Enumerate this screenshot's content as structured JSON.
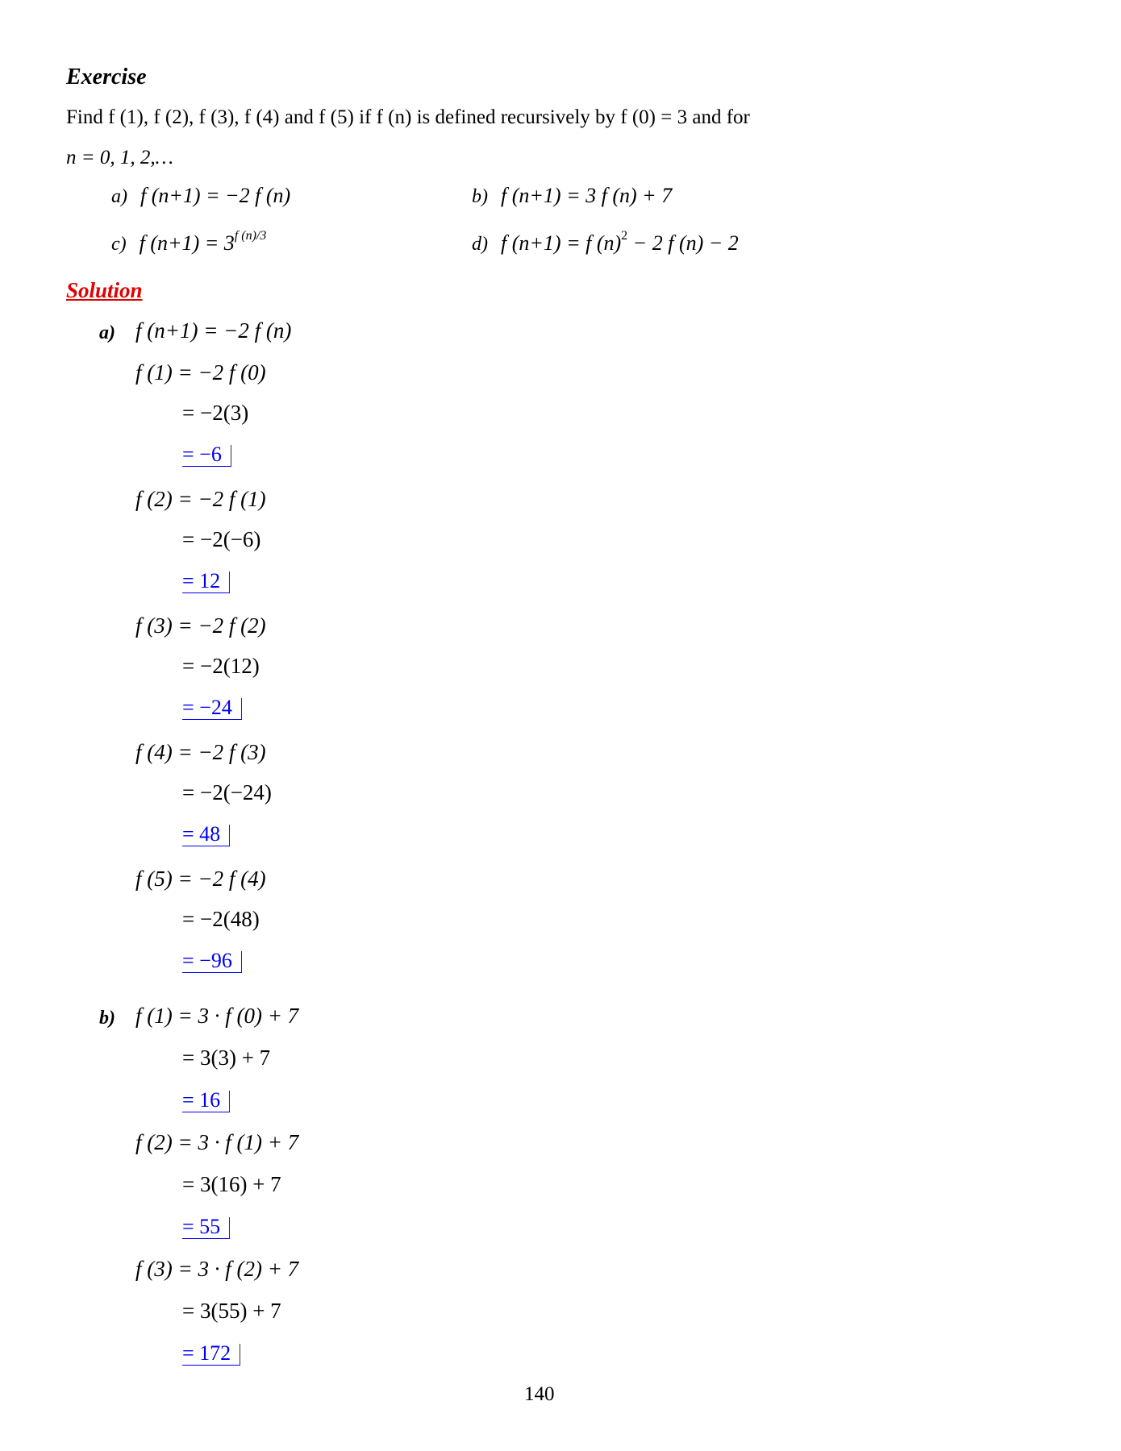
{
  "exercise": {
    "heading": "Exercise",
    "prompt_line1": "Find f (1), f (2), f (3), f (4) and f (5) if f (n) is defined recursively by f (0) = 3 and for",
    "prompt_line2": "n = 0, 1, 2,…",
    "options": [
      {
        "label": "a)",
        "expr": "f (n+1) = −2 f (n)"
      },
      {
        "label": "b)",
        "expr": "f (n+1) = 3 f (n) + 7"
      },
      {
        "label": "c)",
        "expr_base": "f (n+1) = 3",
        "expr_sup": "f (n)/3"
      },
      {
        "label": "d)",
        "expr_base": "f (n+1) = f (n)",
        "expr_sup": "2",
        "expr_tail": " − 2 f (n) − 2"
      }
    ]
  },
  "solution": {
    "heading": "Solution",
    "part_a": {
      "label": "a)",
      "rule": "f (n+1) = −2 f (n)",
      "steps": [
        {
          "expr": "f (1) = −2 f (0)",
          "work": "= −2(3)",
          "answer": "= −6"
        },
        {
          "expr": "f (2) = −2 f (1)",
          "work": "= −2(−6)",
          "answer": "= 12"
        },
        {
          "expr": "f (3) = −2 f (2)",
          "work": "= −2(12)",
          "answer": "= −24"
        },
        {
          "expr": "f (4) = −2 f (3)",
          "work": "= −2(−24)",
          "answer": "= 48"
        },
        {
          "expr": "f (5) = −2 f (4)",
          "work": "= −2(48)",
          "answer": "= −96"
        }
      ]
    },
    "part_b": {
      "label": "b)",
      "steps": [
        {
          "expr": "f (1) = 3 · f (0) + 7",
          "work": "= 3(3) + 7",
          "answer": "= 16"
        },
        {
          "expr": "f (2) = 3 · f (1) + 7",
          "work": "= 3(16) + 7",
          "answer": "= 55"
        },
        {
          "expr": "f (3) = 3 · f (2) + 7",
          "work": "= 3(55) + 7",
          "answer": "= 172"
        }
      ]
    }
  },
  "page_number": "140"
}
